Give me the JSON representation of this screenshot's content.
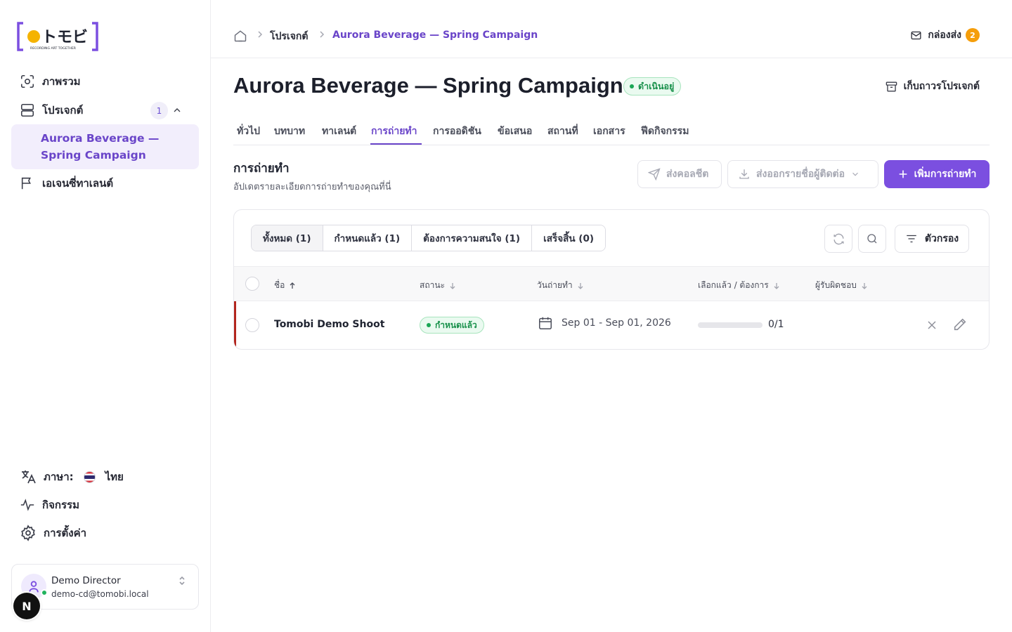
{
  "brand": {
    "logo_text": "トモビ",
    "tagline": "RECORDING ART TOGETHER",
    "accent": "#7b4fe0",
    "logo_dot": "#f5b301"
  },
  "sidebar": {
    "overview": "ภาพรวม",
    "projects": "โปรเจกต์",
    "projects_count": "1",
    "active_project": "Aurora Beverage — Spring Campaign",
    "talent_agencies": "เอเจนซี่ทาเลนต์",
    "language_label": "ภาษา:",
    "language_value": "ไทย",
    "activity": "กิจกรรม",
    "settings": "การตั้งค่า"
  },
  "user": {
    "name": "Demo Director",
    "email": "demo-cd@tomobi.local",
    "dev_badge": "N"
  },
  "breadcrumb": {
    "projects": "โปรเจกต์",
    "current": "Aurora Beverage — Spring Campaign"
  },
  "header": {
    "inbox_label": "กล่องส่ง",
    "inbox_count": "2"
  },
  "project": {
    "title": "Aurora Beverage — Spring Campaign",
    "status": "ดำเนินอยู่",
    "archive_label": "เก็บถาวรโปรเจกต์"
  },
  "tabs": [
    "ทั่วไป",
    "บทบาท",
    "ทาเลนต์",
    "การถ่ายทำ",
    "การออดิชัน",
    "ข้อเสนอ",
    "สถานที่",
    "เอกสาร",
    "ฟีดกิจกรรม"
  ],
  "active_tab": 3,
  "section": {
    "title": "การถ่ายทำ",
    "subtitle": "อัปเดตรายละเอียดการถ่ายทำของคุณที่นี่",
    "send_callsheet": "ส่งคอลชีต",
    "export_contacts": "ส่งออกรายชื่อผู้ติดต่อ",
    "add_shoot": "เพิ่มการถ่ายทำ"
  },
  "filters": {
    "segments": [
      "ทั้งหมด (1)",
      "กำหนดแล้ว (1)",
      "ต้องการความสนใจ (1)",
      "เสร็จสิ้น (0)"
    ],
    "active_segment": 0,
    "filter_label": "ตัวกรอง"
  },
  "table": {
    "columns": [
      "ชื่อ",
      "สถานะ",
      "วันถ่ายทำ",
      "เลือกแล้ว / ต้องการ",
      "ผู้รับผิดชอบ"
    ],
    "rows": [
      {
        "name": "Tomobi Demo Shoot",
        "status": "กำหนดแล้ว",
        "dates": "Sep 01 - Sep 01, 2026",
        "selected": 0,
        "required": 1,
        "count_label": "0/1",
        "owner": ""
      }
    ]
  }
}
